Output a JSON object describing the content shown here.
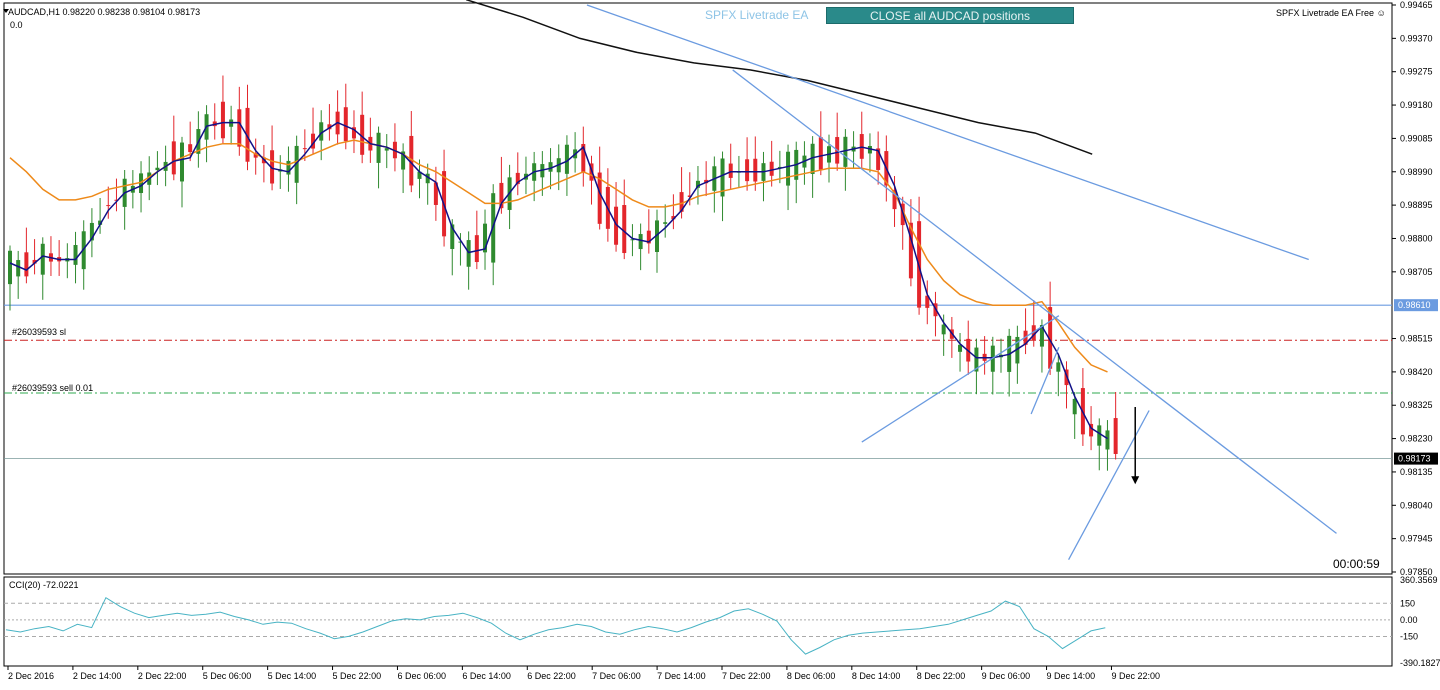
{
  "header": {
    "symbol_line": "AUDCAD,H1  0.98220 0.98238 0.98104 0.98173",
    "sub_line": "0.0",
    "ea_name": "SPFX Livetrade EA",
    "close_button": "CLOSE all AUDCAD positions",
    "ea_free": "SPFX Livetrade EA Free"
  },
  "timer": "00:00:59",
  "orders": {
    "sl_label": "#26039593 sl",
    "sell_label": "#26039593 sell 0.01"
  },
  "colors": {
    "bull": "#2f8a2f",
    "bear": "#e3262c",
    "ma_fast": "#111188",
    "ma_slow": "#ee8a1a",
    "ma_long": "#111111",
    "trendline": "#6b9be0",
    "cci": "#48b3c4",
    "sl_line": "#cc2222",
    "entry_line": "#2fa84f"
  },
  "chart_data": [
    {
      "type": "candlestick",
      "ylim": [
        0.9785,
        0.99465
      ],
      "y_ticks": [
        "0.99465",
        "0.99370",
        "0.99275",
        "0.99180",
        "0.99085",
        "0.98990",
        "0.98895",
        "0.98800",
        "0.98705",
        "0.98515",
        "0.98420",
        "0.98325",
        "0.98230",
        "0.98135",
        "0.98040",
        "0.97945",
        "0.97850"
      ],
      "x_ticks": [
        "2 Dec 2016",
        "2 Dec 14:00",
        "2 Dec 22:00",
        "5 Dec 06:00",
        "5 Dec 14:00",
        "5 Dec 22:00",
        "6 Dec 06:00",
        "6 Dec 14:00",
        "6 Dec 22:00",
        "7 Dec 06:00",
        "7 Dec 14:00",
        "7 Dec 22:00",
        "8 Dec 06:00",
        "8 Dec 14:00",
        "8 Dec 22:00",
        "9 Dec 06:00",
        "9 Dec 14:00",
        "9 Dec 22:00"
      ],
      "levels": {
        "resistance": 0.9861,
        "resistance_label": "0.98610",
        "current": 0.98173,
        "current_label": "0.98173",
        "stop_loss": 0.9851,
        "entry": 0.9836
      },
      "ma_fast": [
        0.9873,
        0.9871,
        0.9875,
        0.9874,
        0.9874,
        0.988,
        0.9888,
        0.9893,
        0.9895,
        0.9899,
        0.9902,
        0.9903,
        0.9912,
        0.9913,
        0.9913,
        0.9905,
        0.99,
        0.9899,
        0.9904,
        0.991,
        0.9913,
        0.9911,
        0.9907,
        0.9906,
        0.9904,
        0.9899,
        0.9896,
        0.9883,
        0.9876,
        0.9877,
        0.989,
        0.9896,
        0.9899,
        0.99,
        0.9902,
        0.9906,
        0.9893,
        0.9884,
        0.988,
        0.9879,
        0.9883,
        0.9888,
        0.9895,
        0.9897,
        0.9899,
        0.9899,
        0.9899,
        0.99,
        0.9901,
        0.9903,
        0.9904,
        0.9905,
        0.9906,
        0.9905,
        0.9895,
        0.988,
        0.9864,
        0.9856,
        0.985,
        0.9846,
        0.9846,
        0.9847,
        0.985,
        0.9855,
        0.9847,
        0.9835,
        0.9826,
        0.9823
      ],
      "ma_slow": [
        0.9903,
        0.9899,
        0.9894,
        0.9891,
        0.9891,
        0.9892,
        0.9894,
        0.9895,
        0.9896,
        0.9899,
        0.9902,
        0.9904,
        0.9906,
        0.9907,
        0.9907,
        0.9904,
        0.9902,
        0.9901,
        0.9903,
        0.9905,
        0.9907,
        0.9908,
        0.9907,
        0.9906,
        0.9904,
        0.9901,
        0.9899,
        0.9896,
        0.9893,
        0.989,
        0.989,
        0.9891,
        0.9893,
        0.9895,
        0.9897,
        0.9899,
        0.9897,
        0.9894,
        0.9891,
        0.9889,
        0.9889,
        0.989,
        0.9892,
        0.9893,
        0.9894,
        0.9895,
        0.9896,
        0.9897,
        0.9898,
        0.9899,
        0.99,
        0.99,
        0.99,
        0.9899,
        0.9893,
        0.9883,
        0.9874,
        0.9868,
        0.9864,
        0.9862,
        0.9861,
        0.9861,
        0.9861,
        0.9862,
        0.9856,
        0.9849,
        0.9844,
        0.9842
      ],
      "ma_long": {
        "x_start": 0.333,
        "x_end": 0.784,
        "values": [
          0.9948,
          0.9943,
          0.9937,
          0.9933,
          0.993,
          0.9928,
          0.9925,
          0.9921,
          0.9917,
          0.9913,
          0.991,
          0.9904
        ]
      },
      "trendlines": [
        {
          "from": [
            0.42,
            0.99465
          ],
          "to": [
            0.94,
            0.9874
          ]
        },
        {
          "from": [
            0.525,
            0.9928
          ],
          "to": [
            0.96,
            0.9796
          ]
        },
        {
          "from": [
            0.618,
            0.9822
          ],
          "to": [
            0.76,
            0.9858
          ]
        },
        {
          "from": [
            0.74,
            0.983
          ],
          "to": [
            0.76,
            0.9849
          ]
        },
        {
          "from": [
            0.767,
            0.97885
          ],
          "to": [
            0.825,
            0.9831
          ]
        }
      ],
      "arrow": {
        "x": 0.815,
        "from": 0.9832,
        "to": 0.981
      }
    },
    {
      "type": "line",
      "title": "CCI(20) -72.0221",
      "ylim": [
        -390.1827,
        360.3569
      ],
      "y_ticks": [
        "360.3569",
        "150",
        "0.00",
        "-150",
        "-390.1827"
      ],
      "levels": [
        150,
        0,
        -150
      ],
      "values": [
        -90,
        -110,
        -80,
        -60,
        -100,
        -40,
        -70,
        200,
        120,
        60,
        20,
        40,
        60,
        40,
        50,
        70,
        30,
        0,
        -40,
        -20,
        -30,
        -80,
        -120,
        -170,
        -150,
        -110,
        -60,
        -10,
        10,
        0,
        30,
        40,
        60,
        20,
        -30,
        -120,
        -180,
        -130,
        -90,
        -70,
        -40,
        -60,
        -110,
        -130,
        -90,
        -60,
        -80,
        -110,
        -70,
        -20,
        20,
        80,
        100,
        50,
        -10,
        -180,
        -310,
        -250,
        -180,
        -140,
        -120,
        -110,
        -100,
        -90,
        -80,
        -60,
        -40,
        0,
        40,
        80,
        170,
        120,
        -80,
        -150,
        -260,
        -180,
        -100,
        -72
      ]
    }
  ]
}
